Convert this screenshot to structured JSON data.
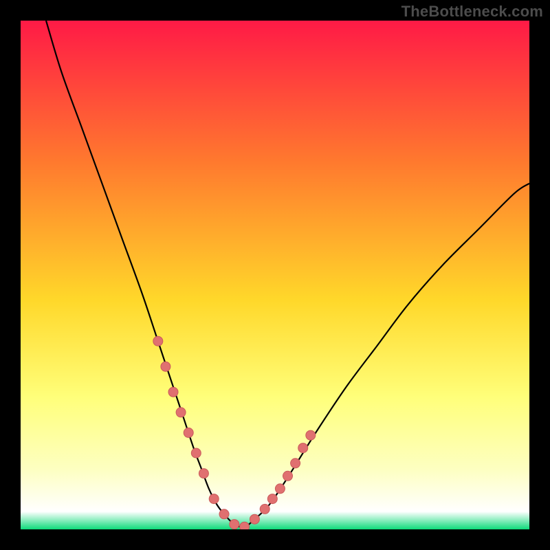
{
  "watermark": "TheBottleneck.com",
  "colors": {
    "frame": "#000000",
    "grad_top": "#ff1a46",
    "grad_mid1": "#ff7a2e",
    "grad_mid2": "#ffd82a",
    "grad_mid3": "#ffff7a",
    "grad_mid4": "#fdffc0",
    "grad_bottom": "#0edb7a",
    "curve": "#000000",
    "marker_fill": "#e07070",
    "marker_stroke": "#c95a5a"
  },
  "chart_data": {
    "type": "line",
    "title": "",
    "xlabel": "",
    "ylabel": "",
    "xlim": [
      0,
      100
    ],
    "ylim": [
      0,
      100
    ],
    "series": [
      {
        "name": "bottleneck-curve",
        "x": [
          5,
          8,
          12,
          16,
          20,
          24,
          27,
          30,
          32,
          34,
          35.5,
          37,
          38.5,
          40,
          42,
          44,
          46,
          49,
          53,
          58,
          64,
          70,
          76,
          83,
          90,
          97,
          100
        ],
        "values": [
          100,
          90,
          79,
          68,
          57,
          46,
          37,
          28,
          22,
          16,
          12,
          8,
          5,
          3,
          1,
          0.5,
          2,
          5,
          11,
          19,
          28,
          36,
          44,
          52,
          59,
          66,
          68
        ]
      }
    ],
    "markers": {
      "name": "highlight-points",
      "x": [
        27,
        28.5,
        30,
        31.5,
        33,
        34.5,
        36,
        38,
        40,
        42,
        44,
        46,
        48,
        49.5,
        51,
        52.5,
        54,
        55.5,
        57
      ],
      "values": [
        37,
        32,
        27,
        23,
        19,
        15,
        11,
        6,
        3,
        1,
        0.5,
        2,
        4,
        6,
        8,
        10.5,
        13,
        16,
        18.5
      ]
    }
  }
}
